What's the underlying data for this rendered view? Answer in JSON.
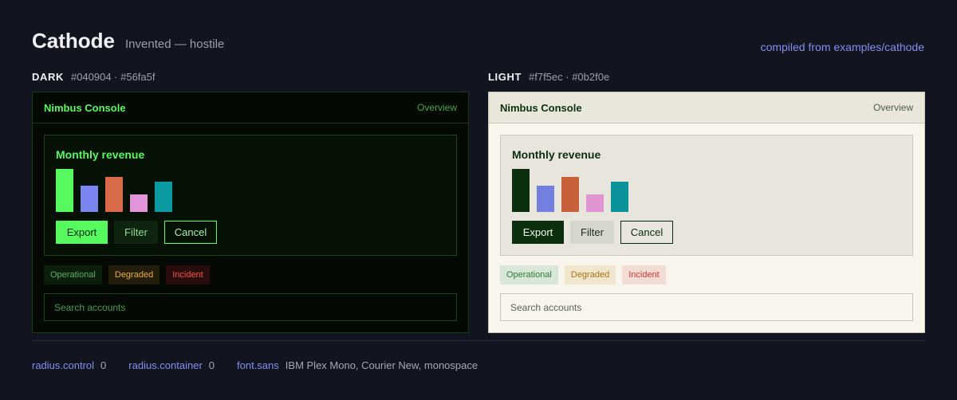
{
  "page": {
    "title": "Cathode",
    "subtitle": "Invented — hostile",
    "compiled_link": "compiled from examples/cathode"
  },
  "themes": {
    "dark": {
      "name": "DARK",
      "hex": "#040904 · #56fa5f",
      "background": "#040904",
      "accent": "#56fa5f",
      "app_name": "Nimbus Console",
      "nav": "Overview",
      "card_title": "Monthly revenue",
      "bars": [
        {
          "value": 54,
          "color": "#56fa5f"
        },
        {
          "value": 33,
          "color": "#7b85f0"
        },
        {
          "value": 44,
          "color": "#d86a48"
        },
        {
          "value": 22,
          "color": "#e494d8"
        },
        {
          "value": 38,
          "color": "#0b9aa2"
        }
      ],
      "buttons": {
        "export": "Export",
        "filter": "Filter",
        "cancel": "Cancel"
      },
      "badges": {
        "operational": "Operational",
        "degraded": "Degraded",
        "incident": "Incident"
      },
      "search_placeholder": "Search accounts"
    },
    "light": {
      "name": "LIGHT",
      "hex": "#f7f5ec · #0b2f0e",
      "background": "#f7f5ec",
      "accent": "#0b2f0e",
      "app_name": "Nimbus Console",
      "nav": "Overview",
      "card_title": "Monthly revenue",
      "bars": [
        {
          "value": 54,
          "color": "#0b2f0e"
        },
        {
          "value": 33,
          "color": "#7480e0"
        },
        {
          "value": 44,
          "color": "#c8603c"
        },
        {
          "value": 22,
          "color": "#e194d2"
        },
        {
          "value": 38,
          "color": "#0a939b"
        }
      ],
      "buttons": {
        "export": "Export",
        "filter": "Filter",
        "cancel": "Cancel"
      },
      "badges": {
        "operational": "Operational",
        "degraded": "Degraded",
        "incident": "Incident"
      },
      "search_placeholder": "Search accounts"
    }
  },
  "tokens": [
    {
      "key": "radius.control",
      "value": "0"
    },
    {
      "key": "radius.container",
      "value": "0"
    },
    {
      "key": "font.sans",
      "value": "IBM Plex Mono, Courier New, monospace"
    }
  ]
}
